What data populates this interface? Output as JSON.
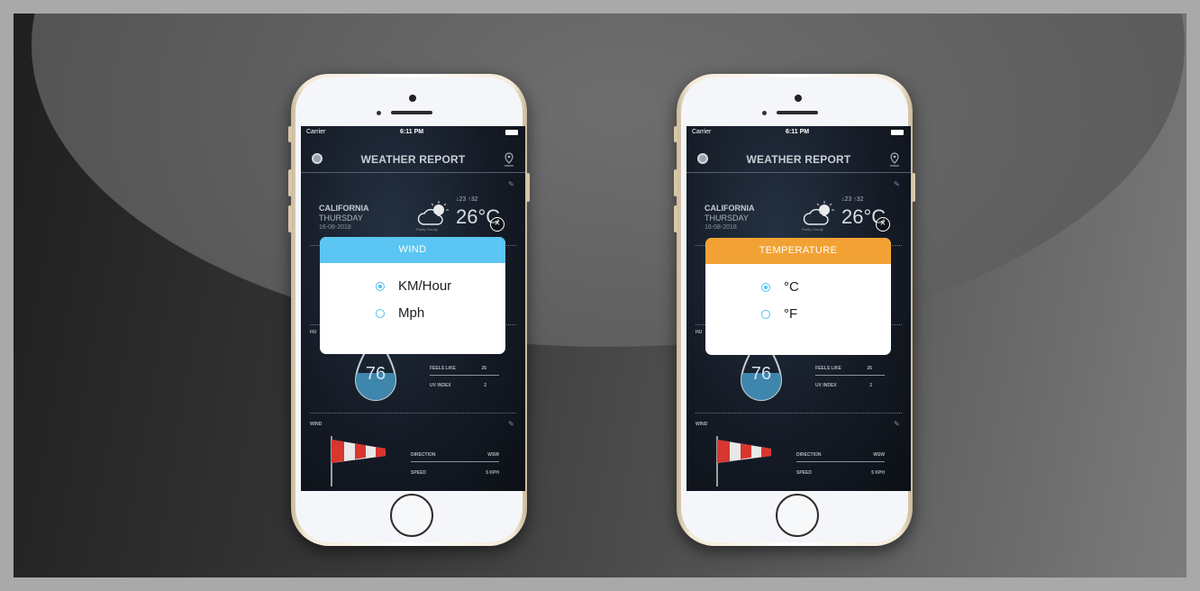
{
  "colors": {
    "wind_header": "#5bc5f3",
    "temperature_header": "#f2a234",
    "radio_accent": "#4cc3f1"
  },
  "phones": [
    {
      "status": {
        "carrier": "Carrier",
        "time": "6:11 PM"
      },
      "app_title": "WEATHER REPORT",
      "current": {
        "city": "CALIFORNIA",
        "day": "THURSDAY",
        "date": "16-08-2018",
        "hilo": "↓23 ↑32",
        "temp": "26°C",
        "condition": "Partly Cloudy"
      },
      "humidity": {
        "label": "HU",
        "value": "76"
      },
      "stats": {
        "feels_like_label": "FEELS LIKE",
        "feels_like": "26",
        "uv_label": "UV INDEX",
        "uv": "2"
      },
      "wind": {
        "label": "WIND",
        "direction_label": "DIRECTION",
        "direction": "WSW",
        "speed_label": "SPEED",
        "speed": "5 KPH"
      },
      "dialog": {
        "title": "WIND",
        "options": [
          "KM/Hour",
          "Mph"
        ],
        "selected": 0
      }
    },
    {
      "status": {
        "carrier": "Carrier",
        "time": "6:11 PM"
      },
      "app_title": "WEATHER REPORT",
      "current": {
        "city": "CALIFORNIA",
        "day": "THURSDAY",
        "date": "16-08-2018",
        "hilo": "↓23 ↑32",
        "temp": "26°C",
        "condition": "Partly Cloudy"
      },
      "humidity": {
        "label": "HU",
        "value": "76"
      },
      "stats": {
        "feels_like_label": "FEELS LIKE",
        "feels_like": "26",
        "uv_label": "UV INDEX",
        "uv": "2"
      },
      "wind": {
        "label": "WIND",
        "direction_label": "DIRECTION",
        "direction": "WSW",
        "speed_label": "SPEED",
        "speed": "5 KPH"
      },
      "dialog": {
        "title": "TEMPERATURE",
        "options": [
          "°C",
          "°F"
        ],
        "selected": 0
      }
    }
  ]
}
